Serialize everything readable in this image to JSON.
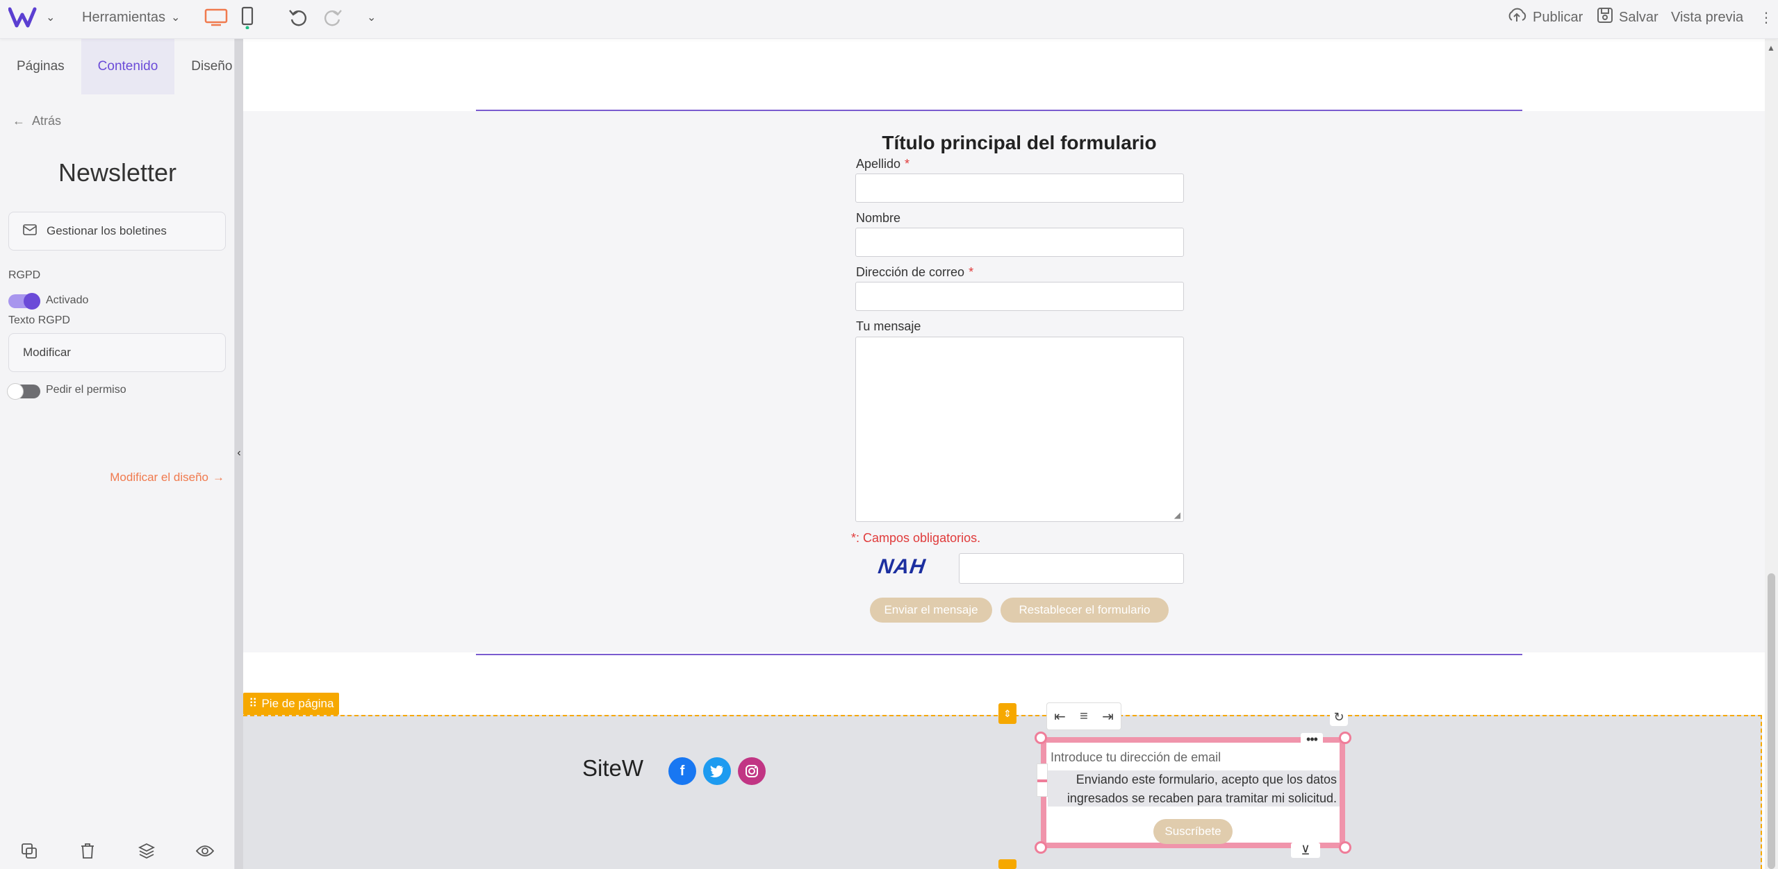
{
  "topbar": {
    "tools_label": "Herramientas",
    "publish_label": "Publicar",
    "save_label": "Salvar",
    "preview_label": "Vista previa",
    "icons": [
      "sitew-logo-icon",
      "desktop-icon",
      "mobile-icon",
      "undo-icon",
      "redo-icon",
      "chevron-down-icon",
      "upload-icon",
      "save-icon",
      "more-vertical-icon"
    ],
    "accent_color": "#f07a4e"
  },
  "sidebar": {
    "tabs": [
      {
        "label": "Páginas"
      },
      {
        "label": "Contenido"
      },
      {
        "label": "Diseño"
      }
    ],
    "back_label": "Atrás",
    "title": "Newsletter",
    "manage_label": "Gestionar los boletines",
    "rgpd_label": "RGPD",
    "rgpd_toggle_label": "Activado",
    "rgpd_text_label": "Texto RGPD",
    "modify_label": "Modificar",
    "permission_label": "Pedir el permiso",
    "design_link": "Modificar el diseño",
    "accent_color": "#6b4bd8"
  },
  "form": {
    "title": "Título principal del formulario",
    "fields": [
      {
        "label": "Apellido",
        "required": "*"
      },
      {
        "label": "Nombre",
        "required": ""
      },
      {
        "label": "Dirección de correo",
        "required": "*"
      },
      {
        "label": "Tu mensaje",
        "required": ""
      }
    ],
    "required_note": "*: Campos obligatorios.",
    "captcha": "NAH",
    "send_label": "Enviar el mensaje",
    "reset_label": "Restablecer el formulario"
  },
  "footer": {
    "tag_label": "Pie de página",
    "site_name": "SiteW",
    "social": [
      "facebook-icon",
      "twitter-icon",
      "instagram-icon"
    ],
    "newsletter": {
      "email_placeholder": "Introduce tu dirección de email",
      "consent_line1": "Enviando este formulario, acepto que los datos",
      "consent_line2": "ingresados se recaben para tramitar mi solicitud.",
      "button_label": "Suscríbete"
    }
  }
}
